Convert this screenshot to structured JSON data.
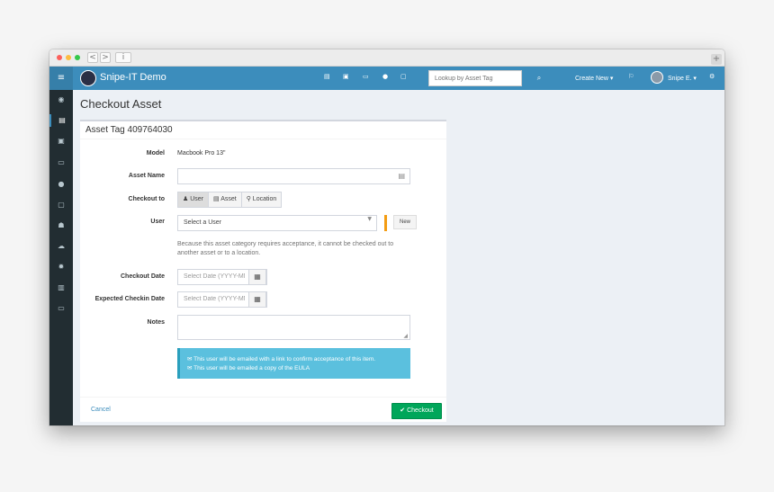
{
  "browser": {
    "back": "<",
    "forward": ">",
    "info": "i",
    "newtab": "+"
  },
  "topnav": {
    "brand": "Snipe-IT Demo",
    "search_placeholder": "Lookup by Asset Tag",
    "create_new": "Create New ▾",
    "user": "Snipe E. ▾",
    "icons": [
      "assets-icon",
      "licenses-icon",
      "accessories-icon",
      "consumables-icon",
      "components-icon",
      "search-icon",
      "flag-icon",
      "settings-icon"
    ]
  },
  "sidebar": {
    "icons": [
      "menu-icon",
      "dashboard-icon",
      "assets-icon",
      "licenses-icon",
      "accessories-icon",
      "consumables-icon",
      "components-icon",
      "users-icon",
      "import-icon",
      "settings-icon",
      "reports-icon",
      "requestable-icon"
    ]
  },
  "page": {
    "title": "Checkout Asset"
  },
  "panel": {
    "title": "Asset Tag 409764030",
    "model_label": "Model",
    "model_value": "Macbook Pro 13\"",
    "asset_name_label": "Asset Name",
    "checkout_to_label": "Checkout to",
    "checkout_options": [
      "User",
      "Asset",
      "Location"
    ],
    "user_label": "User",
    "user_select": "Select a User",
    "new_button": "New",
    "help_text": "Because this asset category requires acceptance, it cannot be checked out to another asset or to a location.",
    "checkout_date_label": "Checkout Date",
    "checkout_date_placeholder": "Select Date (YYYY-MM-DD)",
    "expected_checkin_label": "Expected Checkin Date",
    "expected_checkin_placeholder": "Select Date (YYYY-MM-DD)",
    "notes_label": "Notes",
    "info_lines": [
      "This user will be emailed with a link to confirm acceptance of this item.",
      "This user will be emailed a copy of the EULA"
    ]
  },
  "footer": {
    "cancel": "Cancel",
    "checkout": "✔ Checkout"
  },
  "colors": {
    "primary": "#3c8dbc",
    "sidebar": "#222d32",
    "success": "#00a65a",
    "info": "#5bc0de",
    "warning": "#f39c12"
  }
}
